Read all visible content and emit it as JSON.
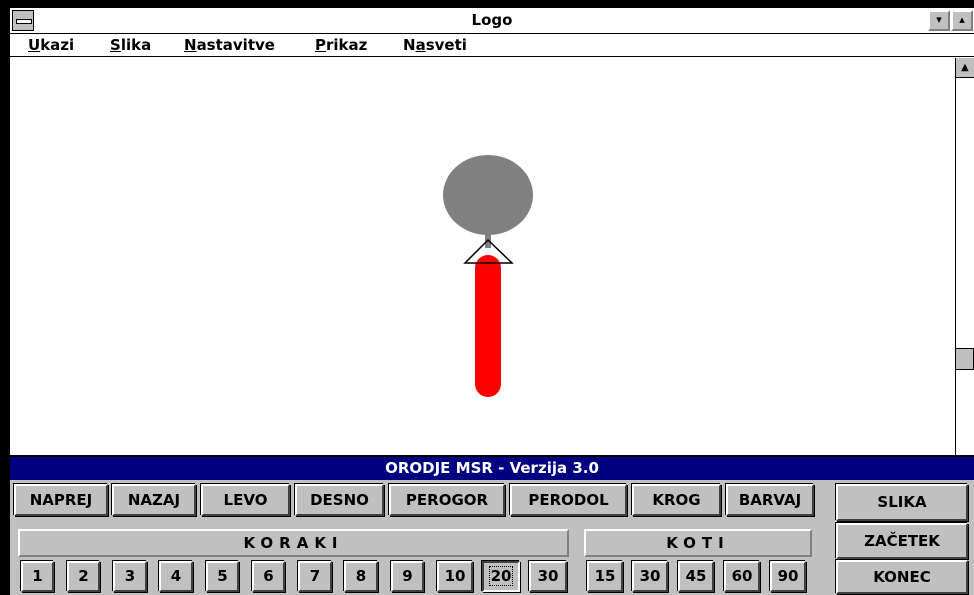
{
  "window": {
    "title": "Logo",
    "minimize_glyph": "▾",
    "maximize_glyph": "▴"
  },
  "menu": [
    {
      "hotkey": "U",
      "rest": "kazi"
    },
    {
      "hotkey": "S",
      "rest": "lika"
    },
    {
      "hotkey": "N",
      "rest": "astavitve"
    },
    {
      "hotkey": "P",
      "rest": "rikaz"
    },
    {
      "pre": "N",
      "hotkey": "a",
      "rest": "sveti"
    }
  ],
  "panel": {
    "title": "ORODJE MSR - Verzija 3.0",
    "commands": [
      "NAPREJ",
      "NAZAJ",
      "LEVO",
      "DESNO",
      "PEROGOR",
      "PERODOL",
      "KROG",
      "BARVAJ"
    ],
    "steps_label": "KORAKI",
    "steps": [
      "1",
      "2",
      "3",
      "4",
      "5",
      "6",
      "7",
      "8",
      "9",
      "10",
      "20",
      "30"
    ],
    "selected_step": "20",
    "angles_label": "KOTI",
    "angles": [
      "15",
      "30",
      "45",
      "60",
      "90"
    ],
    "side_buttons": [
      "SLIKA",
      "ZAČETEK",
      "KONEC"
    ]
  },
  "drawing": {
    "circle_color": "#808080",
    "line_color": "#ff0000",
    "turtle_color": "#000000"
  }
}
